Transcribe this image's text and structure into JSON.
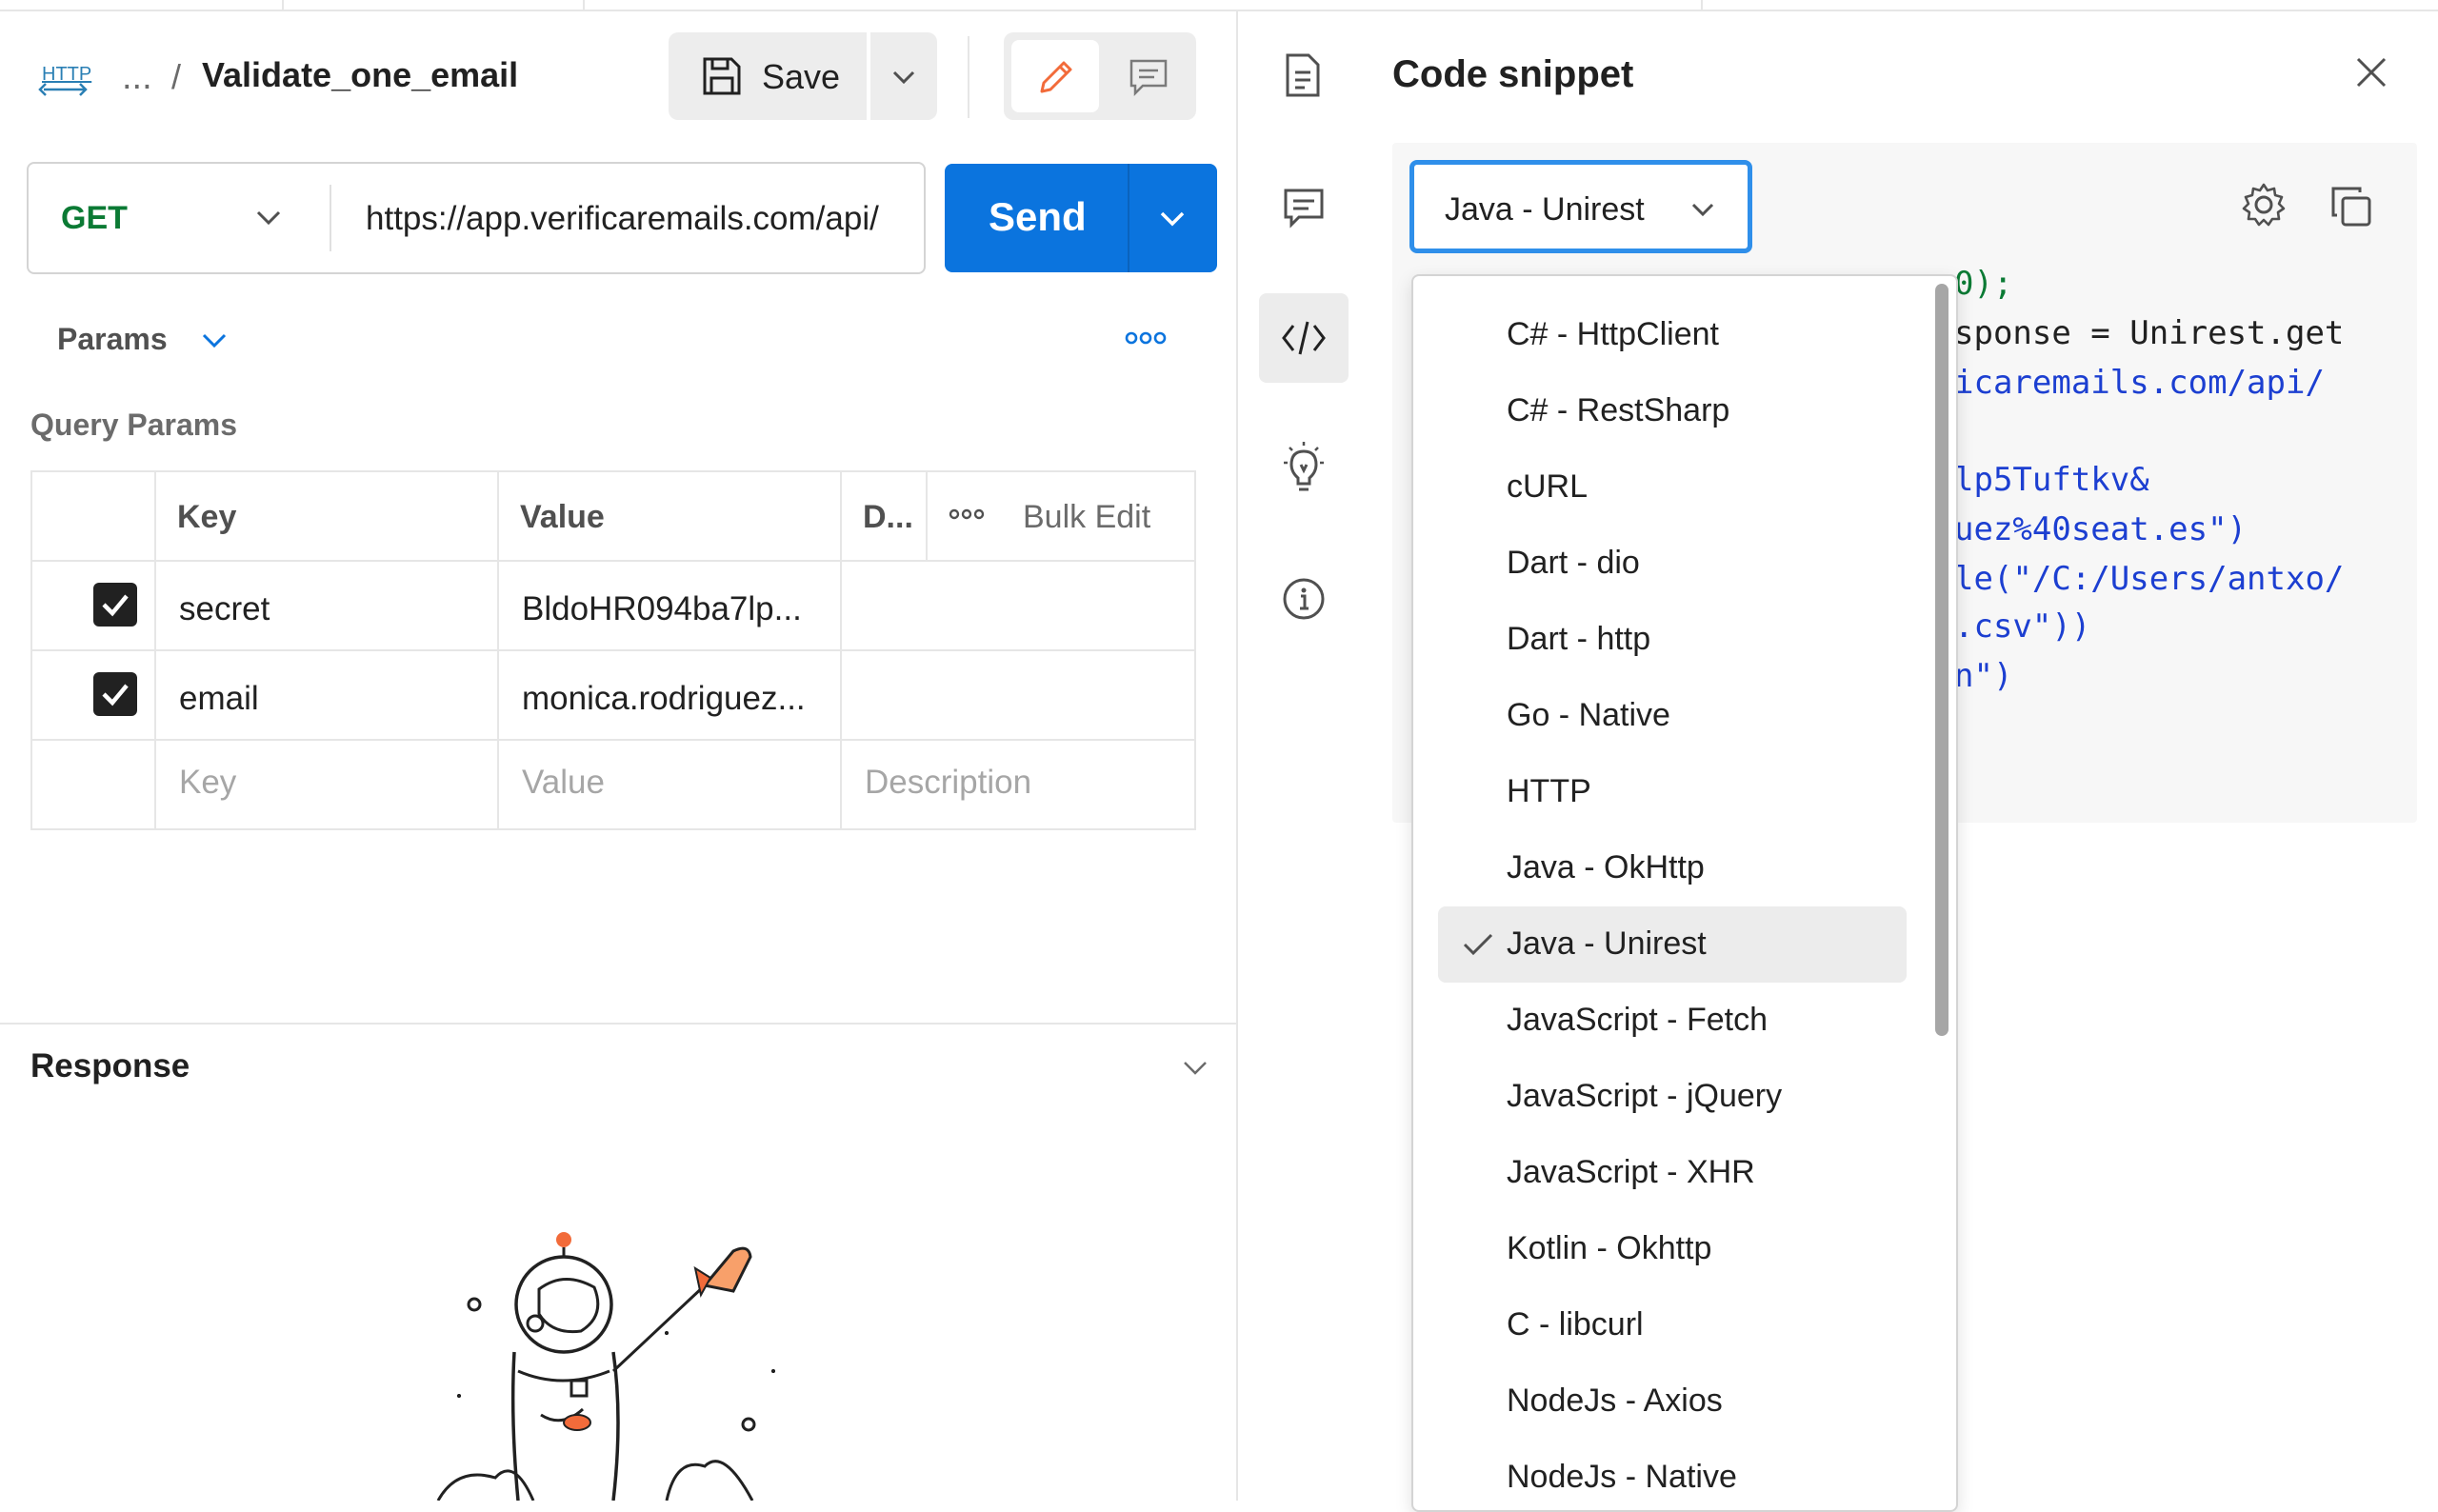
{
  "header": {
    "breadcrumb_ellipsis": "...",
    "breadcrumb_separator": "/",
    "title": "Validate_one_email",
    "save_label": "Save"
  },
  "request": {
    "method": "GET",
    "url": "https://app.verificaremails.com/api/",
    "send_label": "Send"
  },
  "params": {
    "tab_label": "Params",
    "section_title": "Query Params",
    "columns": [
      "Key",
      "Value",
      "D...",
      "Bulk Edit"
    ],
    "rows": [
      {
        "key": "secret",
        "value": "BldoHR094ba7lp...",
        "checked": true
      },
      {
        "key": "email",
        "value": "monica.rodriguez...",
        "checked": true
      }
    ],
    "placeholders": {
      "key": "Key",
      "value": "Value",
      "description": "Description"
    }
  },
  "response": {
    "title": "Response"
  },
  "code_snippet": {
    "title": "Code snippet",
    "selected_language": "Java - Unirest",
    "code_lines": [
      "0);",
      "sponse = Unirest.get",
      "icaremails.com/api/",
      "",
      "lp5Tuftkv&",
      "uez%40seat.es\")",
      "le(\"/C:/Users/antxo/",
      ".csv\"))",
      "n\")"
    ],
    "languages": [
      "C# - HttpClient",
      "C# - RestSharp",
      "cURL",
      "Dart - dio",
      "Dart - http",
      "Go - Native",
      "HTTP",
      "Java - OkHttp",
      "Java - Unirest",
      "JavaScript - Fetch",
      "JavaScript - jQuery",
      "JavaScript - XHR",
      "Kotlin - Okhttp",
      "C - libcurl",
      "NodeJs - Axios",
      "NodeJs - Native"
    ]
  },
  "colors": {
    "accent": "#0b74de",
    "method_get": "#0b7a34",
    "focus_ring": "#2f8fea",
    "edit_icon": "#f26b3a"
  }
}
